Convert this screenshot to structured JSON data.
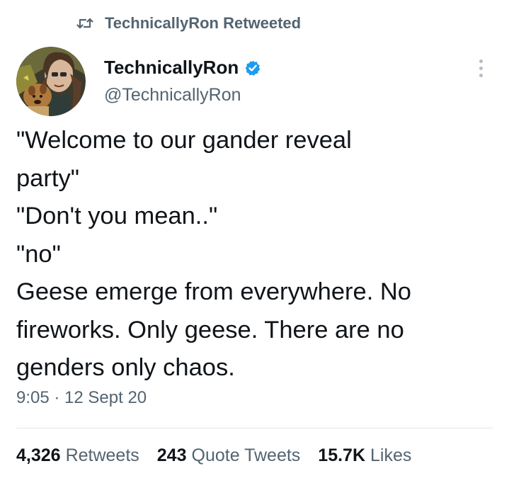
{
  "retweet": {
    "icon": "retweet-icon",
    "label": "TechnicallyRon Retweeted"
  },
  "author": {
    "display_name": "TechnicallyRon",
    "handle": "@TechnicallyRon",
    "verified": true,
    "verified_color": "#1d9bf0"
  },
  "tweet": {
    "lines": [
      "\"Welcome to our gander reveal",
      "party\"",
      "\"Don't you mean..\"",
      "\"no\"",
      "Geese emerge from everywhere. No",
      "fireworks. Only geese. There are no",
      "genders only chaos."
    ],
    "timestamp": "9:05 · 12 Sept 20"
  },
  "stats": {
    "retweets": {
      "count": "4,326",
      "label": "Retweets"
    },
    "quote_tweets": {
      "count": "243",
      "label": "Quote Tweets"
    },
    "likes": {
      "count": "15.7K",
      "label": "Likes"
    }
  },
  "colors": {
    "text_primary": "#0f1419",
    "text_secondary": "#536471",
    "divider": "#e1e6ea"
  }
}
